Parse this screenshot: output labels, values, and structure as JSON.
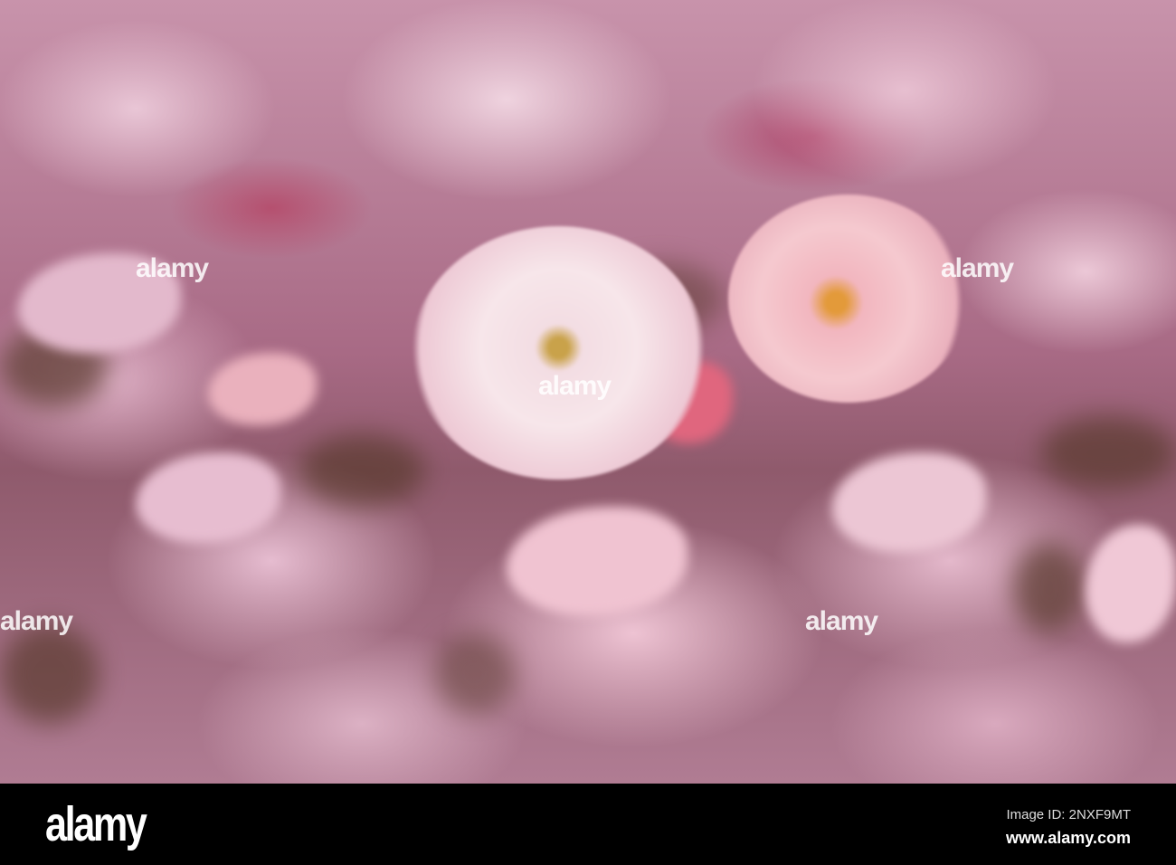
{
  "photo": {
    "subject": "Fallen pink cherry blossom petals",
    "colors": {
      "petal_light": "#f7e6ea",
      "petal_pink": "#e6bcd0",
      "petal_deep": "#b04a6e",
      "soil": "#5a3a2e"
    }
  },
  "watermark": {
    "text": "alamy"
  },
  "footer": {
    "logo": "alamy",
    "image_id": "Image ID: 2NXF9MT",
    "website": "www.alamy.com"
  }
}
